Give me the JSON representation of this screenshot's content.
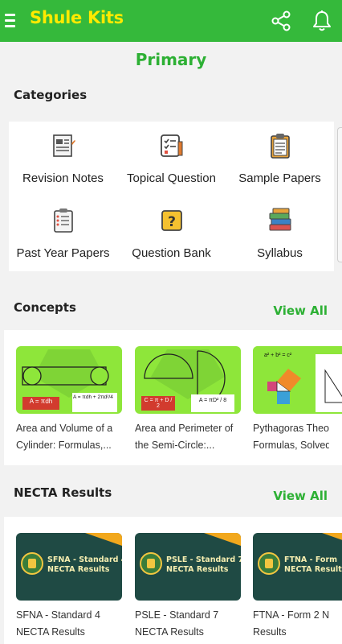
{
  "app": {
    "title": "Shule Kits"
  },
  "page": {
    "title": "Primary"
  },
  "categories": {
    "title": "Categories",
    "items": [
      {
        "label": "Revision Notes",
        "icon": "notes-icon"
      },
      {
        "label": "Topical Question",
        "icon": "checklist-icon"
      },
      {
        "label": "Sample Papers",
        "icon": "clipboard-icon"
      },
      {
        "label": "Past Year Papers",
        "icon": "exam-paper-icon"
      },
      {
        "label": "Question Bank",
        "icon": "question-icon"
      },
      {
        "label": "Syllabus",
        "icon": "books-icon"
      }
    ]
  },
  "concepts": {
    "title": "Concepts",
    "view_all": "View All",
    "items": [
      {
        "line1": "Area and Volume of a",
        "line2": "Cylinder: Formulas,...",
        "formula_a": "A = πdh",
        "formula_b": "A = πdh + 2πd²/4"
      },
      {
        "line1": "Area and Perimeter of",
        "line2": "the Semi-Circle:...",
        "formula_a": "C = π + D / 2",
        "formula_b": "A = πD² / 8"
      },
      {
        "line1": "Pythagoras Theo",
        "line2": "Formulas, Solved",
        "formula_a": "a² + b² = c²"
      }
    ]
  },
  "necta": {
    "title": "NECTA Results",
    "view_all": "View All",
    "items": [
      {
        "banner1": "SFNA - Standard 4",
        "banner2": "NECTA Results",
        "line1": "SFNA - Standard 4",
        "line2": "NECTA Results"
      },
      {
        "banner1": "PSLE - Standard 7",
        "banner2": "NECTA Results",
        "line1": "PSLE - Standard 7",
        "line2": "NECTA Results"
      },
      {
        "banner1": "FTNA - Form",
        "banner2": "NECTA Results",
        "line1": "FTNA - Form 2 N",
        "line2": "Results"
      }
    ]
  },
  "colors": {
    "primary": "#35b93b",
    "title_yellow": "#ffea00",
    "accent_green": "#2db034",
    "card_lime": "#8ee63a"
  }
}
